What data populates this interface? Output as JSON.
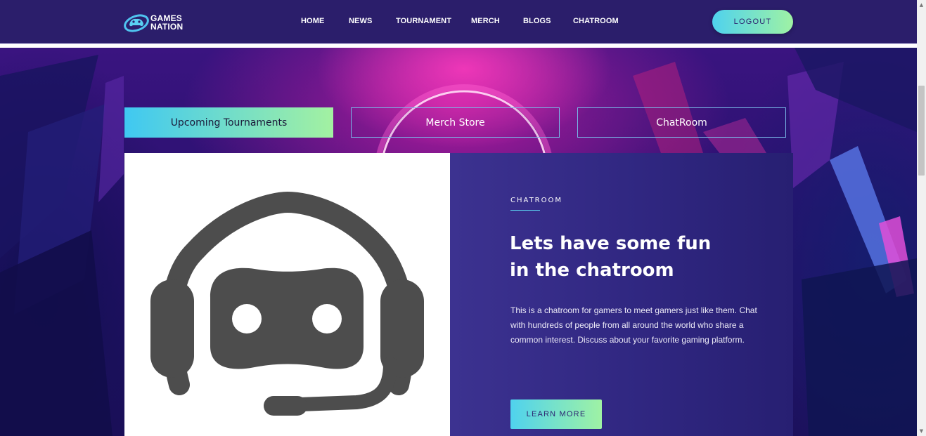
{
  "brand": {
    "line1": "GAMES",
    "line2": "NATION"
  },
  "nav": {
    "items": [
      {
        "label": "HOME"
      },
      {
        "label": "NEWS"
      },
      {
        "label": "TOURNAMENT"
      },
      {
        "label": "MERCH"
      },
      {
        "label": "BLOGS"
      },
      {
        "label": "CHATROOM"
      }
    ],
    "logout_label": "LOGOUT"
  },
  "tabs": [
    {
      "label": "Upcoming Tournaments",
      "active": true
    },
    {
      "label": "Merch Store",
      "active": false
    },
    {
      "label": "ChatRoom",
      "active": false
    }
  ],
  "card": {
    "image_icon": "headset-robot-icon",
    "eyebrow": "CHATROOM",
    "headline_line1": "Lets have some fun",
    "headline_line2": "in the chatroom",
    "description": "This is a chatroom for gamers to meet gamers just like them. Chat with hundreds of people from all around the world who share a common interest. Discuss about your favorite gaming platform.",
    "button_label": "LEARN MORE"
  },
  "colors": {
    "navbar": "#2b1e6b",
    "accent_gradient_start": "#4fd2ee",
    "accent_gradient_end": "#9ff2a4",
    "card_panel": "#302781",
    "icon_gray": "#4d4d4d"
  }
}
